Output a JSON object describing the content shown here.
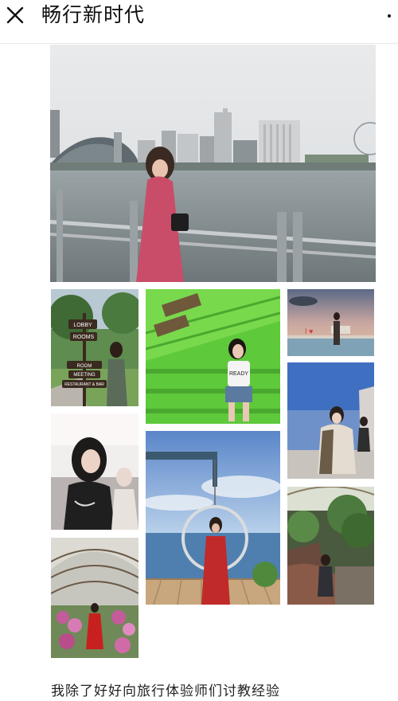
{
  "header": {
    "title": "畅行新时代",
    "close_icon": "close-icon",
    "more_icon": "more-vertical-icon"
  },
  "photo_signs": {
    "lobby": "LOBBY",
    "rooms": "ROOMS",
    "meeting": "MEETING",
    "room": "ROOM",
    "restaurant": "RESTAURANT & BAR",
    "love": "I ♥",
    "ready": "READY"
  },
  "article": {
    "text_line": "我除了好好向旅行体验师们讨教经验"
  },
  "colors": {
    "header_bg": "#ffffff",
    "text": "#222222"
  }
}
